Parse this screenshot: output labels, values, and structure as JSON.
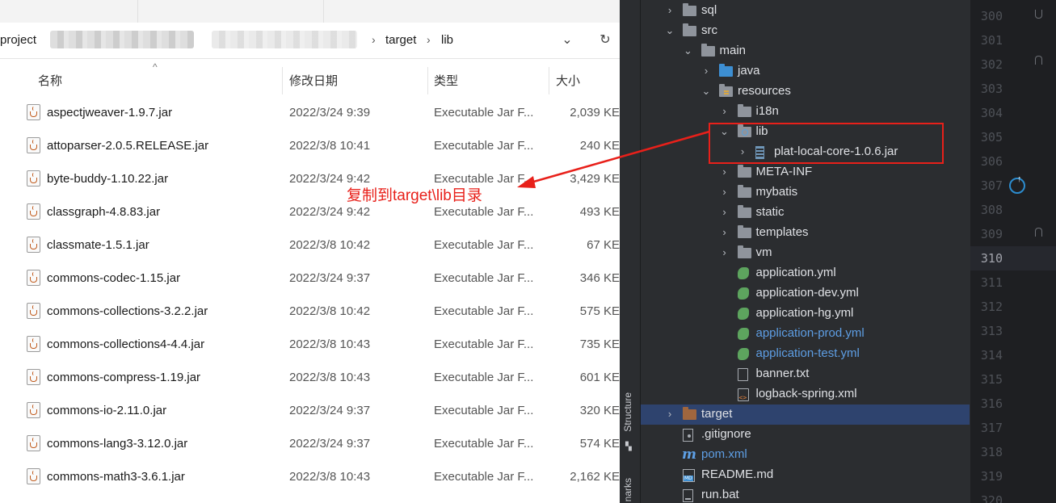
{
  "explorer": {
    "breadcrumb": {
      "project": "project",
      "folder": "target",
      "subfolder": "lib",
      "separator": "›"
    },
    "columns": {
      "name": "名称",
      "date": "修改日期",
      "type": "类型",
      "size": "大小"
    },
    "files": [
      {
        "name": "aspectjweaver-1.9.7.jar",
        "date": "2022/3/24 9:39",
        "type": "Executable Jar F...",
        "size": "2,039 KE"
      },
      {
        "name": "attoparser-2.0.5.RELEASE.jar",
        "date": "2022/3/8 10:41",
        "type": "Executable Jar F...",
        "size": "240 KE"
      },
      {
        "name": "byte-buddy-1.10.22.jar",
        "date": "2022/3/24 9:42",
        "type": "Executable Jar F...",
        "size": "3,429 KE"
      },
      {
        "name": "classgraph-4.8.83.jar",
        "date": "2022/3/24 9:42",
        "type": "Executable Jar F...",
        "size": "493 KE"
      },
      {
        "name": "classmate-1.5.1.jar",
        "date": "2022/3/8 10:42",
        "type": "Executable Jar F...",
        "size": "67 KE"
      },
      {
        "name": "commons-codec-1.15.jar",
        "date": "2022/3/24 9:37",
        "type": "Executable Jar F...",
        "size": "346 KE"
      },
      {
        "name": "commons-collections-3.2.2.jar",
        "date": "2022/3/8 10:42",
        "type": "Executable Jar F...",
        "size": "575 KE"
      },
      {
        "name": "commons-collections4-4.4.jar",
        "date": "2022/3/8 10:43",
        "type": "Executable Jar F...",
        "size": "735 KE"
      },
      {
        "name": "commons-compress-1.19.jar",
        "date": "2022/3/8 10:43",
        "type": "Executable Jar F...",
        "size": "601 KE"
      },
      {
        "name": "commons-io-2.11.0.jar",
        "date": "2022/3/24 9:37",
        "type": "Executable Jar F...",
        "size": "320 KE"
      },
      {
        "name": "commons-lang3-3.12.0.jar",
        "date": "2022/3/24 9:37",
        "type": "Executable Jar F...",
        "size": "574 KE"
      },
      {
        "name": "commons-math3-3.6.1.jar",
        "date": "2022/3/8 10:43",
        "type": "Executable Jar F...",
        "size": "2,162 KE"
      }
    ]
  },
  "annotation": {
    "text": "复制到target\\lib目录",
    "color": "#e8201a"
  },
  "ide": {
    "side_tabs": {
      "structure": "Structure",
      "bookmarks": "narks"
    },
    "tree": [
      {
        "label": "sql",
        "icon": "folder-icon",
        "chevron": "›",
        "depth": 1
      },
      {
        "label": "src",
        "icon": "folder-icon",
        "chevron": "⌄",
        "depth": 1
      },
      {
        "label": "main",
        "icon": "folder-icon",
        "chevron": "⌄",
        "depth": 2
      },
      {
        "label": "java",
        "icon": "java-source-folder-icon",
        "chevron": "›",
        "depth": 3
      },
      {
        "label": "resources",
        "icon": "resources-folder-icon",
        "chevron": "⌄",
        "depth": 3
      },
      {
        "label": "i18n",
        "icon": "folder-icon",
        "chevron": "›",
        "depth": 4
      },
      {
        "label": "lib",
        "icon": "library-folder-icon",
        "chevron": "⌄",
        "depth": 4
      },
      {
        "label": "plat-local-core-1.0.6.jar",
        "icon": "jar-icon",
        "chevron": "›",
        "depth": 5
      },
      {
        "label": "META-INF",
        "icon": "folder-icon",
        "chevron": "›",
        "depth": 4
      },
      {
        "label": "mybatis",
        "icon": "folder-icon",
        "chevron": "›",
        "depth": 4
      },
      {
        "label": "static",
        "icon": "folder-icon",
        "chevron": "›",
        "depth": 4
      },
      {
        "label": "templates",
        "icon": "folder-icon",
        "chevron": "›",
        "depth": 4
      },
      {
        "label": "vm",
        "icon": "folder-icon",
        "chevron": "›",
        "depth": 4
      },
      {
        "label": "application.yml",
        "icon": "spring-leaf-icon",
        "chevron": "",
        "depth": 4
      },
      {
        "label": "application-dev.yml",
        "icon": "spring-leaf-icon",
        "chevron": "",
        "depth": 4
      },
      {
        "label": "application-hg.yml",
        "icon": "spring-leaf-icon",
        "chevron": "",
        "depth": 4
      },
      {
        "label": "application-prod.yml",
        "icon": "spring-leaf-icon",
        "chevron": "",
        "depth": 4,
        "modified": true
      },
      {
        "label": "application-test.yml",
        "icon": "spring-leaf-icon",
        "chevron": "",
        "depth": 4,
        "modified": true
      },
      {
        "label": "banner.txt",
        "icon": "text-file-icon",
        "chevron": "",
        "depth": 4
      },
      {
        "label": "logback-spring.xml",
        "icon": "xml-file-icon",
        "chevron": "",
        "depth": 4
      },
      {
        "label": "target",
        "icon": "excluded-folder-icon",
        "chevron": "›",
        "depth": 1,
        "selected": true
      },
      {
        "label": ".gitignore",
        "icon": "gitignore-icon",
        "chevron": "",
        "depth": 1
      },
      {
        "label": "pom.xml",
        "icon": "maven-icon",
        "chevron": "",
        "depth": 1,
        "modified": true
      },
      {
        "label": "README.md",
        "icon": "markdown-icon",
        "chevron": "",
        "depth": 1
      },
      {
        "label": "run.bat",
        "icon": "bat-file-icon",
        "chevron": "",
        "depth": 1
      }
    ],
    "line_numbers": [
      "300",
      "301",
      "302",
      "303",
      "304",
      "305",
      "306",
      "307",
      "308",
      "309",
      "310",
      "311",
      "312",
      "313",
      "314",
      "315",
      "316",
      "317",
      "318",
      "319",
      "320"
    ],
    "current_line": "310",
    "colors": {
      "selection": "#2e436e",
      "modified_text": "#5e9ee4",
      "highlight_box": "#e8201a"
    }
  }
}
